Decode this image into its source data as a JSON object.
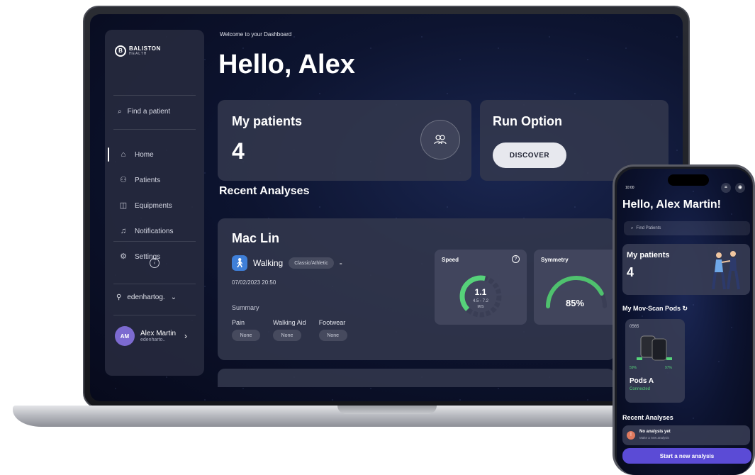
{
  "sidebar": {
    "logo_title": "BALISTON",
    "logo_subtitle": "HEALTH",
    "logo_mark": "B",
    "search_label": "Find a patient",
    "items": [
      {
        "label": "Home",
        "icon": "home-icon",
        "glyph": "⌂"
      },
      {
        "label": "Patients",
        "icon": "patients-icon",
        "glyph": "⚇"
      },
      {
        "label": "Equipments",
        "icon": "equipment-icon",
        "glyph": "◫"
      },
      {
        "label": "Notifications",
        "icon": "bell-icon",
        "glyph": "♫"
      },
      {
        "label": "Settings",
        "icon": "gear-icon",
        "glyph": "⚙"
      }
    ],
    "collapse_glyph": "‹",
    "org": "edenhartog.",
    "user": {
      "initials": "AM",
      "name": "Alex Martin",
      "sub": "edenharto.."
    }
  },
  "header": {
    "welcome": "Welcome to your Dashboard",
    "hello": "Hello, Alex"
  },
  "my_patients": {
    "title": "My patients",
    "count": "4"
  },
  "run_option": {
    "title": "Run Option",
    "button": "DISCOVER"
  },
  "recent": {
    "title": "Recent Analyses",
    "item": {
      "patient": "Mac Lin",
      "activity": "Walking",
      "tag": "Classic/Athletic",
      "dash": "-",
      "datetime": "07/02/2023 20:50",
      "summary_label": "Summary",
      "summary": [
        {
          "label": "Pain",
          "value": "None"
        },
        {
          "label": "Walking Aid",
          "value": "None"
        },
        {
          "label": "Footwear",
          "value": "None"
        }
      ],
      "speed": {
        "label": "Speed",
        "value": "1.1",
        "range": "4.5 - 7.2",
        "unit": "M/S",
        "level": 0.55
      },
      "symmetry": {
        "label": "Symmetry",
        "value": "85%",
        "level": 0.85
      }
    }
  },
  "phone": {
    "time": "10:00",
    "hello": "Hello, Alex Martin!",
    "search_placeholder": "Find Patients",
    "patients_title": "My patients",
    "patients_count": "4",
    "pods_title": "My Mov-Scan Pods",
    "pod": {
      "id": "0565",
      "battery_left": "59%",
      "battery_right": "97%",
      "name": "Pods A",
      "status": "Connected"
    },
    "recent_title": "Recent Analyses",
    "no_analysis_title": "No analysis yet",
    "no_analysis_sub": "Make a new analysis",
    "start_button": "Start a new analysis"
  },
  "colors": {
    "accent": "#5b4bd6",
    "walking_badge": "#3f7fd8",
    "success": "#56d27a",
    "avatar": "#7c6ad0"
  }
}
